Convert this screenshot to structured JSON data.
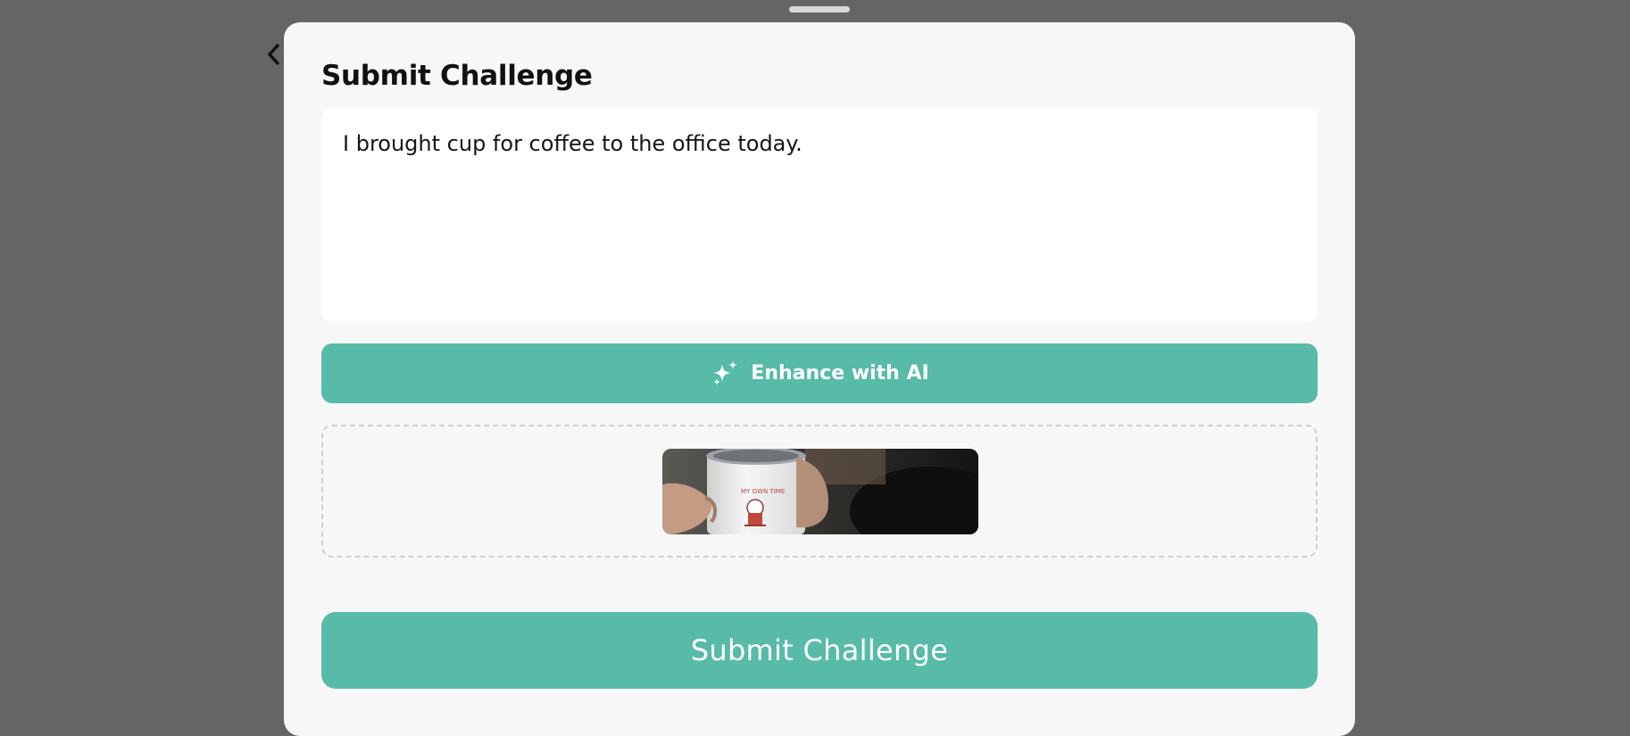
{
  "sheet": {
    "title": "Submit Challenge"
  },
  "challenge_text": {
    "value": "I brought cup for coffee to the office today."
  },
  "enhance_button": {
    "label": "Enhance with AI",
    "icon": "sparkles-icon"
  },
  "navigation": {
    "back_icon": "chevron-left-icon"
  },
  "attachment": {
    "image_description": "photo-of-hands-holding-white-coffee-mug"
  },
  "submit_button": {
    "label": "Submit Challenge"
  },
  "colors": {
    "accent": "#57bba8",
    "backdrop": "#656565",
    "sheet_background": "#f7f7f7"
  }
}
